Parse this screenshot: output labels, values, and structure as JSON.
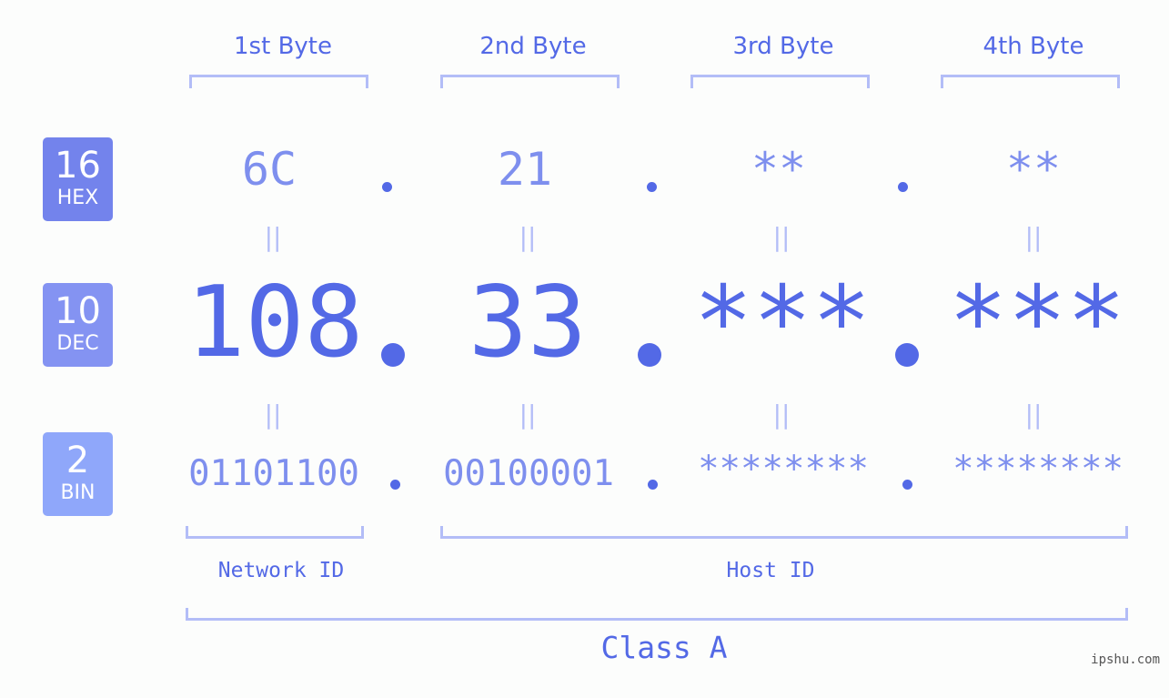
{
  "bytes": [
    {
      "header": "1st Byte",
      "hex": "6C",
      "dec": "108",
      "bin": "01101100"
    },
    {
      "header": "2nd Byte",
      "hex": "21",
      "dec": "33",
      "bin": "00100001"
    },
    {
      "header": "3rd Byte",
      "hex": "**",
      "dec": "***",
      "bin": "********"
    },
    {
      "header": "4th Byte",
      "hex": "**",
      "dec": "***",
      "bin": "********"
    }
  ],
  "bases": {
    "hex": {
      "number": "16",
      "label": "HEX",
      "color": "#7383ec"
    },
    "dec": {
      "number": "10",
      "label": "DEC",
      "color": "#8493f2"
    },
    "bin": {
      "number": "2",
      "label": "BIN",
      "color": "#8fa7fa"
    }
  },
  "equals_symbol": "||",
  "separator": ".",
  "network_id_label": "Network ID",
  "host_id_label": "Host ID",
  "class_label": "Class A",
  "watermark": "ipshu.com",
  "colors": {
    "primary": "#5369e6",
    "secondary": "#7e8fee",
    "bracket": "#b3bdf7",
    "background": "#fcfdfc"
  }
}
